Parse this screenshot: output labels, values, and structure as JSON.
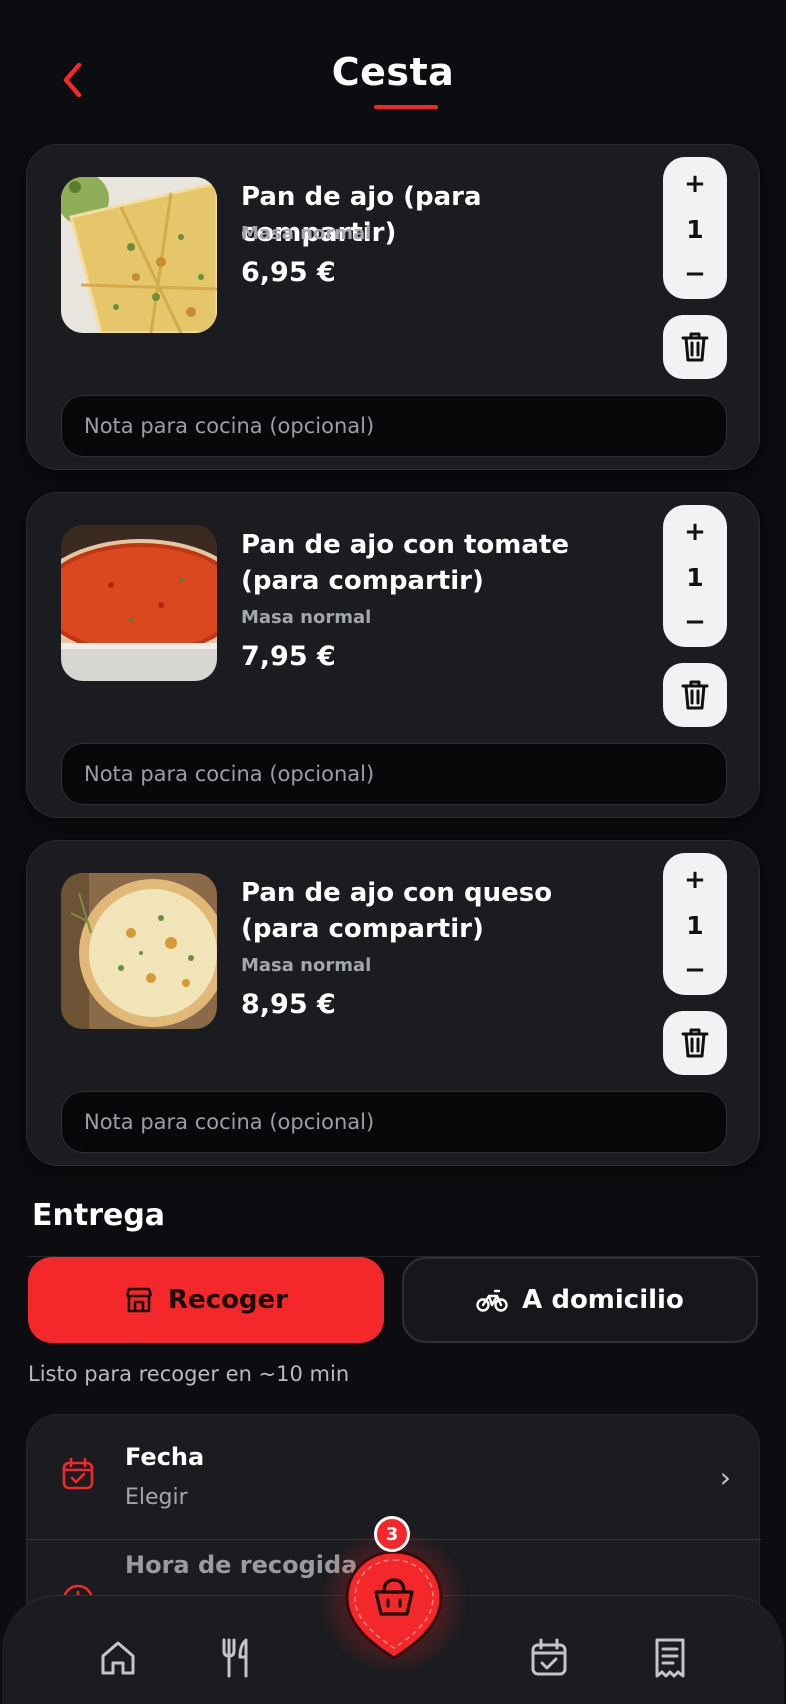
{
  "header": {
    "title": "Cesta"
  },
  "colors": {
    "accent": "#f4282b",
    "background": "#0c0d10",
    "card": "#1b1c20"
  },
  "items": [
    {
      "name": "Pan de ajo (para compartir)",
      "variant": "Masa normal",
      "price": "6,95 €",
      "quantity": "1",
      "note_placeholder": "Nota para cocina (opcional)",
      "image": "garlic-bread-pizza"
    },
    {
      "name": "Pan de ajo con tomate (para compartir)",
      "variant": "Masa normal",
      "price": "7,95 €",
      "quantity": "1",
      "note_placeholder": "Nota para cocina (opcional)",
      "image": "tomato-pizza"
    },
    {
      "name": "Pan de ajo con queso (para compartir)",
      "variant": "Masa normal",
      "price": "8,95 €",
      "quantity": "1",
      "note_placeholder": "Nota para cocina (opcional)",
      "image": "cheese-pizza"
    }
  ],
  "stepper": {
    "plus": "+",
    "minus": "−"
  },
  "delivery": {
    "title": "Entrega",
    "pickup_label": "Recoger",
    "delivery_label": "A domicilio",
    "ready_text": "Listo para recoger en ~10 min"
  },
  "options": [
    {
      "label": "Fecha",
      "value": "Elegir",
      "icon": "calendar-icon"
    },
    {
      "label": "Hora de recogida",
      "value": "",
      "icon": "clock-icon"
    }
  ],
  "cart": {
    "count": "3"
  },
  "nav": [
    "home-icon",
    "utensils-icon",
    "cart-icon",
    "calendar-check-icon",
    "receipt-icon"
  ]
}
